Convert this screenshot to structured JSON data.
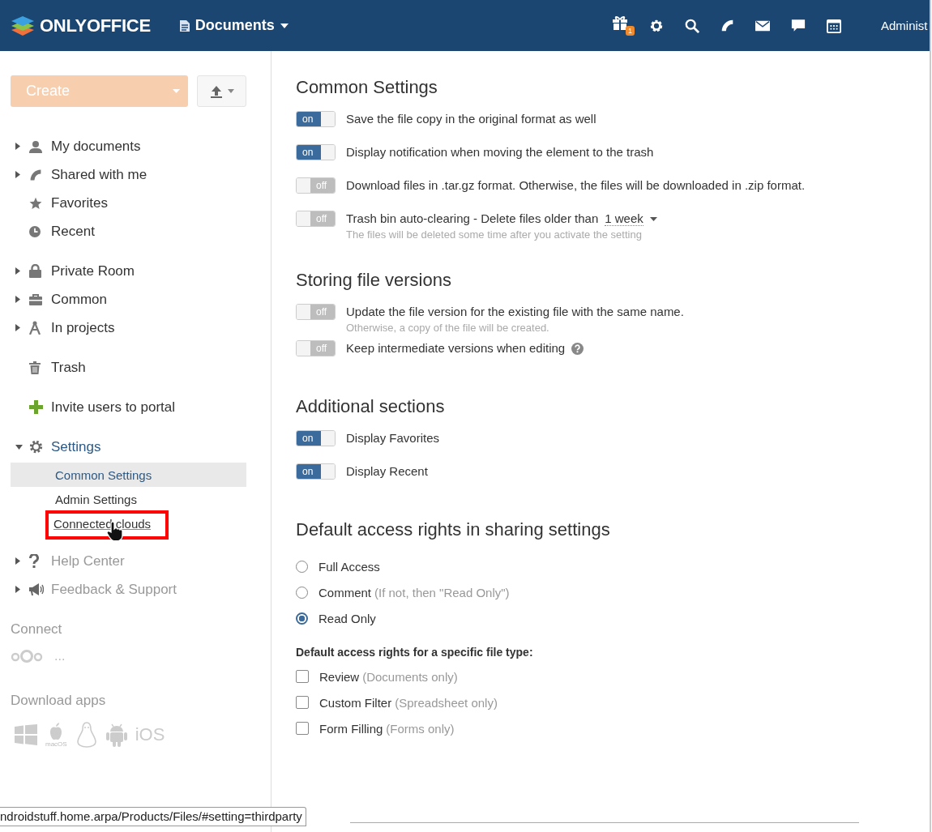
{
  "header": {
    "logo": "ONLYOFFICE",
    "module": "Documents",
    "gift_badge": "1",
    "user": "Administ"
  },
  "sidebar": {
    "create_button": "Create",
    "groups": [
      {
        "items": [
          {
            "label": "My documents",
            "expanded": false
          },
          {
            "label": "Shared with me",
            "expanded": false
          },
          {
            "label": "Favorites"
          },
          {
            "label": "Recent"
          }
        ]
      },
      {
        "items": [
          {
            "label": "Private Room",
            "expanded": false
          },
          {
            "label": "Common",
            "expanded": false
          },
          {
            "label": "In projects",
            "expanded": false
          }
        ]
      },
      {
        "items": [
          {
            "label": "Trash"
          }
        ]
      },
      {
        "items": [
          {
            "label": "Invite users to portal"
          }
        ]
      },
      {
        "items": [
          {
            "label": "Settings",
            "expanded": true,
            "children": [
              {
                "label": "Common Settings",
                "selected": true,
                "highlighted": false
              },
              {
                "label": "Admin Settings",
                "selected": false,
                "highlighted": false
              },
              {
                "label": "Connected clouds",
                "selected": false,
                "highlighted": true
              }
            ]
          }
        ]
      },
      {
        "items": [
          {
            "label": "Help Center",
            "expanded": false,
            "disabled": true
          },
          {
            "label": "Feedback & Support",
            "expanded": false,
            "disabled": true
          }
        ]
      }
    ],
    "connect": {
      "title": "Connect",
      "more": "..."
    },
    "download": {
      "title": "Download apps",
      "macos": "macOS",
      "ios": "iOS"
    }
  },
  "sections": [
    {
      "title": "Common Settings",
      "items": [
        {
          "kind": "toggle",
          "on": true,
          "state_text": "on",
          "label": "Save the file copy in the original format as well"
        },
        {
          "kind": "toggle",
          "on": true,
          "state_text": "on",
          "label": "Display notification when moving the element to the trash"
        },
        {
          "kind": "toggle",
          "on": false,
          "state_text": "off",
          "label": "Download files in .tar.gz format. Otherwise, the files will be downloaded in .zip format."
        },
        {
          "kind": "toggle",
          "on": false,
          "state_text": "off",
          "label": "Trash bin auto-clearing - Delete files older than",
          "dropdown": "1 week",
          "hint": "The files will be deleted some time after you activate the setting"
        }
      ]
    },
    {
      "title": "Storing file versions",
      "items": [
        {
          "kind": "toggle",
          "on": false,
          "state_text": "off",
          "label": "Update the file version for the existing file with the same name.",
          "hint": "Otherwise, a copy of the file will be created."
        },
        {
          "kind": "toggle",
          "on": false,
          "state_text": "off",
          "label": "Keep intermediate versions when editing",
          "help": true
        }
      ]
    },
    {
      "title": "Additional sections",
      "items": [
        {
          "kind": "toggle",
          "on": true,
          "state_text": "on",
          "label": "Display Favorites"
        },
        {
          "kind": "toggle",
          "on": true,
          "state_text": "on",
          "label": "Display Recent"
        }
      ]
    },
    {
      "title": "Default access rights in sharing settings",
      "items": [
        {
          "kind": "radio",
          "label": "Full Access",
          "selected": false
        },
        {
          "kind": "radio",
          "label": "Comment",
          "note": "(If not, then \"Read Only\")",
          "selected": false
        },
        {
          "kind": "radio",
          "label": "Read Only",
          "selected": true
        },
        {
          "kind": "subheading",
          "label": "Default access rights for a specific file type:"
        },
        {
          "kind": "checkbox",
          "label": "Review",
          "note": "(Documents only)",
          "checked": false
        },
        {
          "kind": "checkbox",
          "label": "Custom Filter",
          "note": "(Spreadsheet only)",
          "checked": false
        },
        {
          "kind": "checkbox",
          "label": "Form Filling",
          "note": "(Forms only)",
          "checked": false
        }
      ]
    }
  ],
  "status_bar": "ndroidstuff.home.arpa/Products/Files/#setting=thirdparty"
}
